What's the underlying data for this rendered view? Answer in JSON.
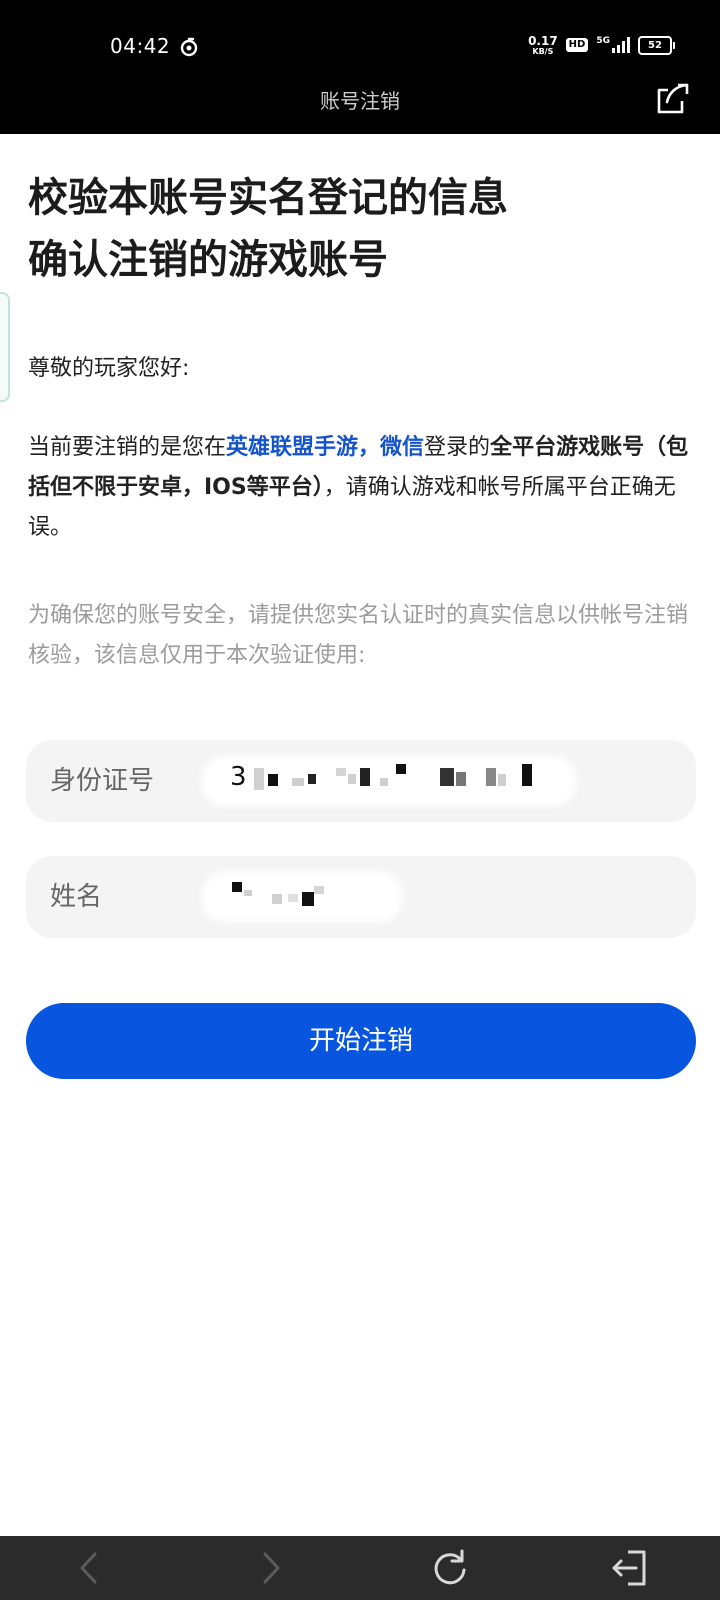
{
  "status_bar": {
    "time": "04:42",
    "net_speed_value": "0.17",
    "net_speed_unit": "KB/S",
    "hd_badge": "HD",
    "network_type": "5G",
    "battery_level": "52"
  },
  "nav": {
    "title": "账号注销"
  },
  "heading": {
    "line1": "校验本账号实名登记的信息",
    "line2": "确认注销的游戏账号"
  },
  "greeting": "尊敬的玩家您好:",
  "description": {
    "prefix": "当前要注销的是您在",
    "game_link": "英雄联盟手游，",
    "login_link": "微信",
    "middle": "登录的",
    "bold_text": "全平台游戏账号（包括但不限于安卓，IOS等平台）",
    "suffix": "，请确认游戏和帐号所属平台正确无误。"
  },
  "security_note": "为确保您的账号安全，请提供您实名认证时的真实信息以供帐号注销核验，该信息仅用于本次验证使用:",
  "form": {
    "id_label": "身份证号",
    "id_value_visible": "3",
    "name_label": "姓名"
  },
  "actions": {
    "start_button": "开始注销"
  },
  "colors": {
    "primary": "#0856df",
    "link": "#1655c9",
    "muted_text": "#9c9c9c",
    "field_bg": "#f4f4f5"
  },
  "icons": {
    "app_status": "refresh-like-icon",
    "share": "share-export-icon",
    "back": "chevron-left-icon",
    "forward": "chevron-right-icon",
    "reload": "reload-icon",
    "exit": "exit-icon"
  }
}
